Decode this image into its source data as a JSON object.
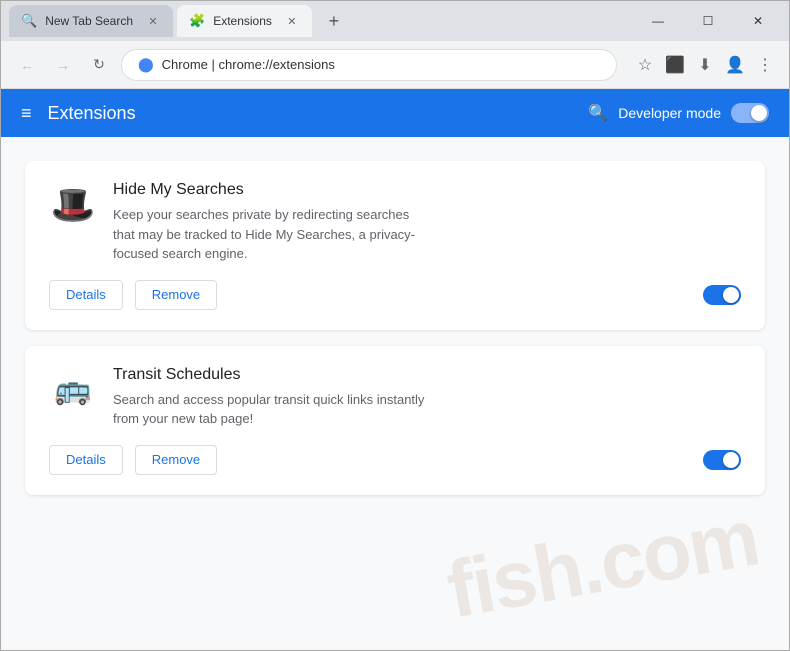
{
  "browser": {
    "tabs": [
      {
        "id": "tab-new-tab-search",
        "label": "New Tab Search",
        "icon": "🔍",
        "active": false
      },
      {
        "id": "tab-extensions",
        "label": "Extensions",
        "icon": "🧩",
        "active": true
      }
    ],
    "new_tab_label": "+",
    "address_bar": {
      "subdomain": "Chrome | ",
      "path": "chrome://extensions",
      "full": "chrome://extensions"
    },
    "window_controls": {
      "minimize": "—",
      "maximize": "☐",
      "close": "✕"
    }
  },
  "header": {
    "menu_icon": "≡",
    "title": "Extensions",
    "search_icon": "🔍",
    "developer_mode_label": "Developer mode",
    "toggle_on": true
  },
  "extensions": [
    {
      "id": "hide-my-searches",
      "name": "Hide My Searches",
      "icon": "🎩",
      "description": "Keep your searches private by redirecting searches that may be tracked to Hide My Searches, a privacy-focused search engine.",
      "details_label": "Details",
      "remove_label": "Remove",
      "enabled": true
    },
    {
      "id": "transit-schedules",
      "name": "Transit Schedules",
      "icon": "🚌",
      "description": "Search and access popular transit quick links instantly from your new tab page!",
      "details_label": "Details",
      "remove_label": "Remove",
      "enabled": true
    }
  ],
  "watermark": {
    "text": "fish.com"
  }
}
